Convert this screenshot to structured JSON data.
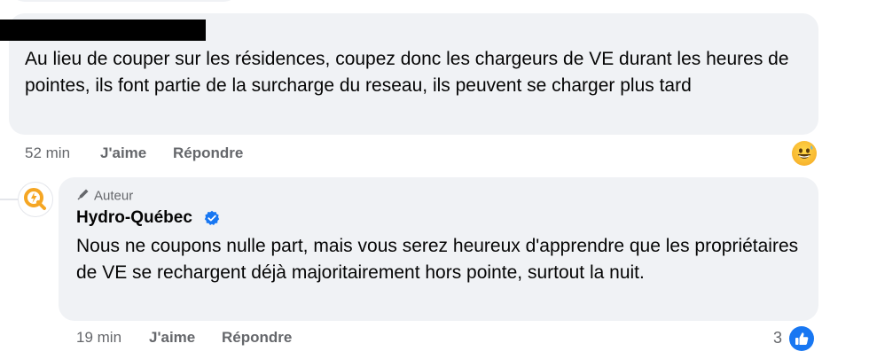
{
  "comment1": {
    "text": "Au lieu de couper sur les résidences, coupez donc les chargeurs de VE durant les heures de pointes, ils font partie de la surcharge du reseau, ils peuvent se charger plus tard",
    "time": "52 min",
    "like_label": "J'aime",
    "reply_label": "Répondre",
    "reaction_icon": "grinning-sweat-emoji"
  },
  "comment2": {
    "role_label": "Auteur",
    "author": "Hydro-Québec",
    "verified": true,
    "text": "Nous ne coupons nulle part, mais vous serez heureux d'apprendre que les propriétaires de VE se rechargent déjà majoritairement hors pointe, surtout la nuit.",
    "time": "19 min",
    "like_label": "J'aime",
    "reply_label": "Répondre",
    "reaction_count": "3",
    "reaction_icon": "thumbs-up-icon"
  },
  "colors": {
    "bubble": "#f0f2f5",
    "meta_text": "#65676b",
    "facebook_blue": "#1877f2",
    "hydro_orange": "#f5a623"
  }
}
